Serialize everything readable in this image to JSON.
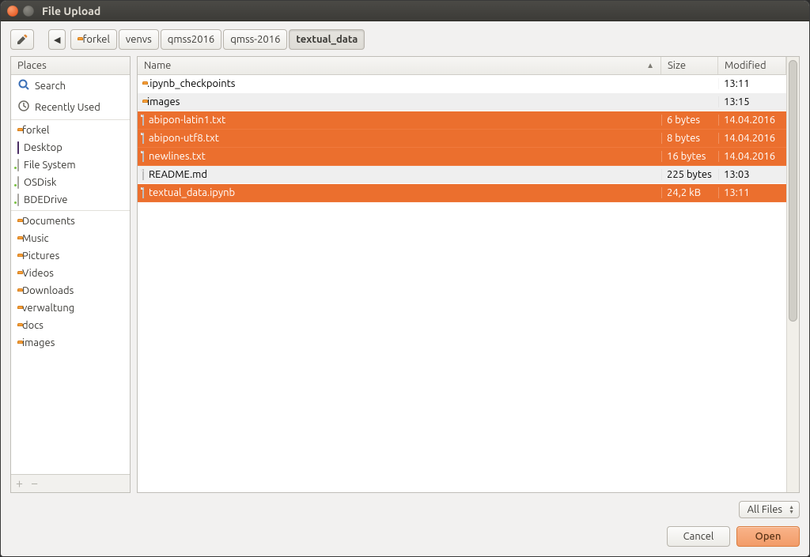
{
  "window": {
    "title": "File Upload"
  },
  "toolbar": {
    "back_tooltip": "Back",
    "breadcrumb": [
      "forkel",
      "venvs",
      "qmss2016",
      "qmss-2016",
      "textual_data"
    ],
    "current_index": 4
  },
  "sidebar": {
    "header": "Places",
    "groups": [
      [
        {
          "icon": "search",
          "label": "Search"
        },
        {
          "icon": "recent",
          "label": "Recently Used"
        }
      ],
      [
        {
          "icon": "home-folder",
          "label": "forkel"
        },
        {
          "icon": "desktop",
          "label": "Desktop"
        },
        {
          "icon": "drive",
          "label": "File System"
        },
        {
          "icon": "drive",
          "label": "OSDisk"
        },
        {
          "icon": "drive",
          "label": "BDEDrive"
        }
      ],
      [
        {
          "icon": "folder",
          "label": "Documents"
        },
        {
          "icon": "folder",
          "label": "Music"
        },
        {
          "icon": "folder",
          "label": "Pictures"
        },
        {
          "icon": "folder",
          "label": "Videos"
        },
        {
          "icon": "folder",
          "label": "Downloads"
        },
        {
          "icon": "folder",
          "label": "verwaltung"
        },
        {
          "icon": "folder",
          "label": "docs"
        },
        {
          "icon": "folder",
          "label": "images"
        }
      ]
    ],
    "add_label": "+",
    "remove_label": "−"
  },
  "fileview": {
    "columns": {
      "name": "Name",
      "size": "Size",
      "modified": "Modified"
    },
    "sort_column": "name",
    "rows": [
      {
        "type": "folder",
        "name": ".ipynb_checkpoints",
        "size": "",
        "modified": "13:11",
        "selected": false
      },
      {
        "type": "folder",
        "name": "images",
        "size": "",
        "modified": "13:15",
        "selected": false
      },
      {
        "type": "file",
        "name": "abipon-latin1.txt",
        "size": "6 bytes",
        "modified": "14.04.2016",
        "selected": true
      },
      {
        "type": "file",
        "name": "abipon-utf8.txt",
        "size": "8 bytes",
        "modified": "14.04.2016",
        "selected": true
      },
      {
        "type": "file",
        "name": "newlines.txt",
        "size": "16 bytes",
        "modified": "14.04.2016",
        "selected": true
      },
      {
        "type": "file",
        "name": "README.md",
        "size": "225 bytes",
        "modified": "13:03",
        "selected": false
      },
      {
        "type": "file",
        "name": "textual_data.ipynb",
        "size": "24,2 kB",
        "modified": "13:11",
        "selected": true
      }
    ]
  },
  "footer": {
    "filter_label": "All Files",
    "cancel_label": "Cancel",
    "open_label": "Open"
  }
}
